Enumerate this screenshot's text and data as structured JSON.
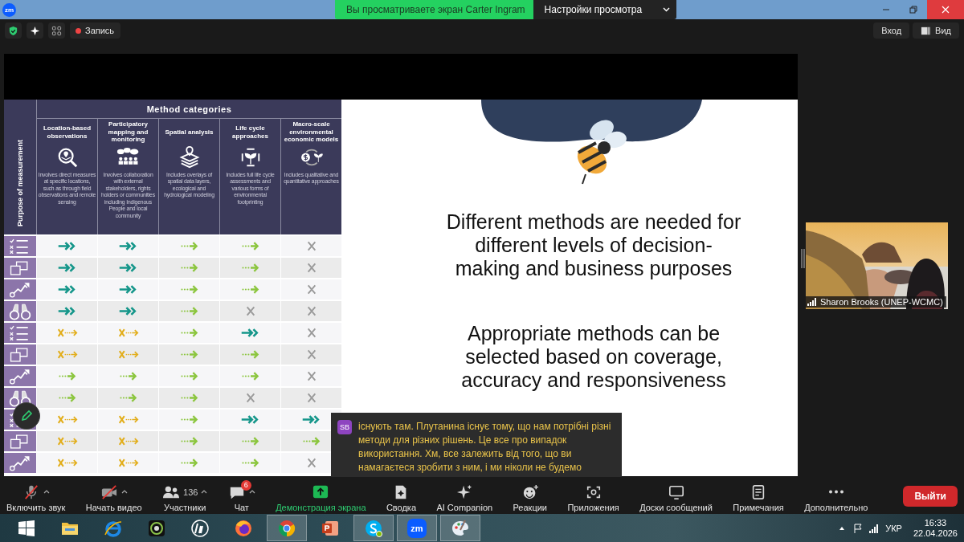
{
  "title_bar": {
    "app_logo": "zm",
    "share_banner": "Вы просматриваете экран Carter Ingram",
    "view_options": "Настройки просмотра"
  },
  "meeting_bar": {
    "record": "Запись",
    "sign_in": "Вход",
    "view": "Вид"
  },
  "slide": {
    "table": {
      "title": "Method categories",
      "row_header": "Purpose of measurement",
      "columns": [
        {
          "kind": "location",
          "title": "Location-based observations",
          "description": "Involves direct measures at specific locations, such as through field observations and remote sensing"
        },
        {
          "kind": "people",
          "title": "Participatory mapping and monitoring",
          "description": "Involves collaboration with external stakeholders, rights holders or communities including Indigenous People and local community"
        },
        {
          "kind": "layers",
          "title": "Spatial analysis",
          "description": "Includes overlays of spatial data layers, ecological and hydrological modeling"
        },
        {
          "kind": "cycle",
          "title": "Life cycle approaches",
          "description": "Includes full life cycle assessments and various forms of environmental footprinting"
        },
        {
          "kind": "money",
          "title": "Macro-scale environmental economic models",
          "description": "Includes qualitative and quantitative approaches"
        }
      ],
      "rows": [
        {
          "kind": "checklist",
          "cells": [
            {
              "kind": "double"
            },
            {
              "kind": "double"
            },
            {
              "kind": "dotted"
            },
            {
              "kind": "dotted"
            },
            {
              "kind": "cross"
            }
          ]
        },
        {
          "kind": "squares",
          "cells": [
            {
              "kind": "double"
            },
            {
              "kind": "double"
            },
            {
              "kind": "dotted"
            },
            {
              "kind": "dotted"
            },
            {
              "kind": "cross"
            }
          ]
        },
        {
          "kind": "trend",
          "cells": [
            {
              "kind": "double"
            },
            {
              "kind": "double"
            },
            {
              "kind": "dotted"
            },
            {
              "kind": "dotted"
            },
            {
              "kind": "cross"
            }
          ]
        },
        {
          "kind": "binoculars",
          "cells": [
            {
              "kind": "double"
            },
            {
              "kind": "double"
            },
            {
              "kind": "dotted"
            },
            {
              "kind": "cross"
            },
            {
              "kind": "cross"
            }
          ]
        },
        {
          "kind": "checklist",
          "cells": [
            {
              "kind": "xdot"
            },
            {
              "kind": "xdot"
            },
            {
              "kind": "dotted"
            },
            {
              "kind": "double"
            },
            {
              "kind": "cross"
            }
          ]
        },
        {
          "kind": "squares",
          "cells": [
            {
              "kind": "xdot"
            },
            {
              "kind": "xdot"
            },
            {
              "kind": "dotted"
            },
            {
              "kind": "dotted"
            },
            {
              "kind": "cross"
            }
          ]
        },
        {
          "kind": "trend",
          "cells": [
            {
              "kind": "dotted"
            },
            {
              "kind": "dotted"
            },
            {
              "kind": "dotted"
            },
            {
              "kind": "dotted"
            },
            {
              "kind": "cross"
            }
          ]
        },
        {
          "kind": "binoculars",
          "cells": [
            {
              "kind": "dotted"
            },
            {
              "kind": "dotted"
            },
            {
              "kind": "dotted"
            },
            {
              "kind": "cross"
            },
            {
              "kind": "cross"
            }
          ]
        },
        {
          "kind": "checklist",
          "cells": [
            {
              "kind": "xdot"
            },
            {
              "kind": "xdot"
            },
            {
              "kind": "dotted"
            },
            {
              "kind": "double"
            },
            {
              "kind": "double"
            }
          ]
        },
        {
          "kind": "squares",
          "cells": [
            {
              "kind": "xdot"
            },
            {
              "kind": "xdot"
            },
            {
              "kind": "dotted"
            },
            {
              "kind": "dotted"
            },
            {
              "kind": "dotted"
            }
          ]
        },
        {
          "kind": "trend",
          "cells": [
            {
              "kind": "xdot"
            },
            {
              "kind": "xdot"
            },
            {
              "kind": "dotted"
            },
            {
              "kind": "dotted"
            },
            {
              "kind": "cross"
            }
          ]
        }
      ]
    },
    "headline": "Different methods are needed for different levels of decision-making and business purposes",
    "subline": "Appropriate methods can be selected based on coverage, accuracy and responsiveness"
  },
  "video": {
    "name": "Sharon Brooks (UNEP-WCMC)"
  },
  "caption": {
    "initials": "SB",
    "text": "існують там. Плутанина існує тому, що нам потрібні різні методи для різних рішень. Це все про випадок використання. Хм, все залежить від того, що ви намагаєтеся зробити з ним, і ми ніколи не будемо"
  },
  "toolbar": {
    "items": [
      {
        "kind": "mic",
        "label": "Включить звук",
        "caret": true,
        "active": false
      },
      {
        "kind": "video",
        "label": "Начать видео",
        "caret": true,
        "active": false
      },
      {
        "kind": "people",
        "label": "Участники",
        "count": "136",
        "caret": true,
        "active": false
      },
      {
        "kind": "chat",
        "label": "Чат",
        "badge": "6",
        "caret": true,
        "active": false
      },
      {
        "kind": "share",
        "label": "Демонстрация экрана",
        "caret": false,
        "active": true
      },
      {
        "kind": "summary",
        "label": "Сводка",
        "caret": false,
        "active": false
      },
      {
        "kind": "ai",
        "label": "AI Companion",
        "caret": false,
        "active": false
      },
      {
        "kind": "reactions",
        "label": "Реакции",
        "caret": false,
        "active": false
      },
      {
        "kind": "apps",
        "label": "Приложения",
        "caret": false,
        "active": false
      },
      {
        "kind": "boards",
        "label": "Доски сообщений",
        "caret": false,
        "active": false
      },
      {
        "kind": "notes",
        "label": "Примечания",
        "caret": false,
        "active": false
      },
      {
        "kind": "more",
        "label": "Дополнительно",
        "caret": false,
        "active": false
      }
    ],
    "leave": "Выйти"
  },
  "taskbar": {
    "apps": [
      {
        "kind": "start",
        "open": false
      },
      {
        "kind": "explorer",
        "open": false
      },
      {
        "kind": "ie",
        "open": false
      },
      {
        "kind": "camera",
        "open": false
      },
      {
        "kind": "hp",
        "open": false
      },
      {
        "kind": "firefox",
        "open": false
      },
      {
        "kind": "chrome",
        "open": true
      },
      {
        "kind": "powerpoint",
        "open": false
      },
      {
        "kind": "skype",
        "open": true
      },
      {
        "kind": "zoom",
        "label": "zm",
        "open": true
      },
      {
        "kind": "paint",
        "open": true
      }
    ],
    "language": "УКР",
    "time": "16:33",
    "date": "22.04.2026"
  }
}
